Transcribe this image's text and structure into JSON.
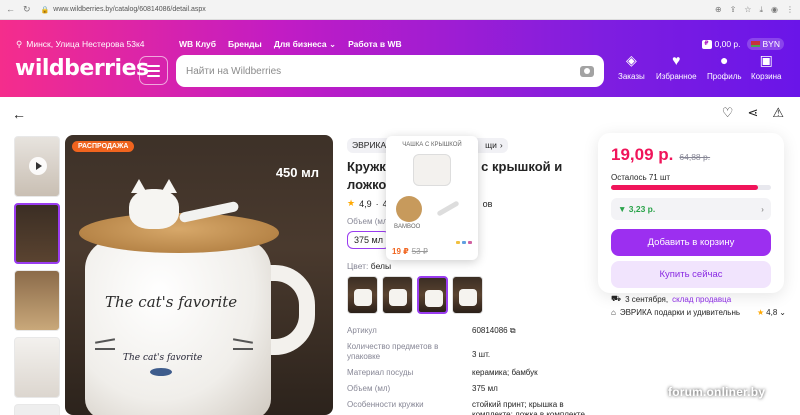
{
  "browser": {
    "url": "www.wildberries.by/catalog/60814086/detail.aspx"
  },
  "header": {
    "location": "Минск, Улица Нестерова 53к4",
    "links": [
      "WB Клуб",
      "Бренды",
      "Для бизнеса",
      "Работа в WB"
    ],
    "wallet": "0,00 р.",
    "currency": "BYN",
    "logo": "wildberries",
    "search_placeholder": "Найти на Wildberries",
    "nav": [
      {
        "label": "Заказы",
        "icon": "box-icon"
      },
      {
        "label": "Избранное",
        "icon": "heart-icon"
      },
      {
        "label": "Профиль",
        "icon": "user-icon"
      },
      {
        "label": "Корзина",
        "icon": "cart-icon"
      }
    ]
  },
  "product": {
    "sale_badge": "РАСПРОДАЖА",
    "volume_badge": "450 мл",
    "mug_text": "The cat's favorite",
    "mug_subtext": "The cat's favorite",
    "brand": "ЭВРИКА п",
    "brand_tail": "щи",
    "title_line1": "Кружка",
    "title_tail1": "тик с крышкой и",
    "title_line2": "ложкой",
    "title_tail2": "ов",
    "rating": "4,9",
    "reviews_count": "49",
    "volume_label": "Объем (мл",
    "volume_value": "375 мл",
    "color_label": "Цвет:",
    "color_value": "белы"
  },
  "popup": {
    "text_top": "ЧАШКА С КРЫШКОЙ",
    "text_mid": "BAMBOO",
    "price": "19 ₽",
    "old_price": "53 ₽"
  },
  "specs": [
    {
      "k": "Артикул",
      "v": "60814086"
    },
    {
      "k": "Количество предметов в упаковке",
      "v": "3 шт."
    },
    {
      "k": "Материал посуды",
      "v": "керамика; бамбук"
    },
    {
      "k": "Объем (мл)",
      "v": "375 мл"
    },
    {
      "k": "Особенности кружки",
      "v": "стойкий принт; крышка в комплекте; ложка в комплекте"
    }
  ],
  "buybox": {
    "price": "19,09 р.",
    "old_price": "64,88 р.",
    "left": "Осталось 71 шт",
    "left_fill": 0.92,
    "cashback": "▼ 3,23 р.",
    "add_to_cart": "Добавить в корзину",
    "buy_now": "Купить сейчас"
  },
  "delivery": {
    "date": "3 сентября,",
    "source": "склад продавца",
    "seller": "ЭВРИКА подарки и удивительнь",
    "seller_rating": "4,8"
  },
  "watermark": "forum.onliner.by",
  "colors": {
    "accent": "#9c2ff0",
    "price": "#f0145a",
    "sale": "#f0641e"
  }
}
